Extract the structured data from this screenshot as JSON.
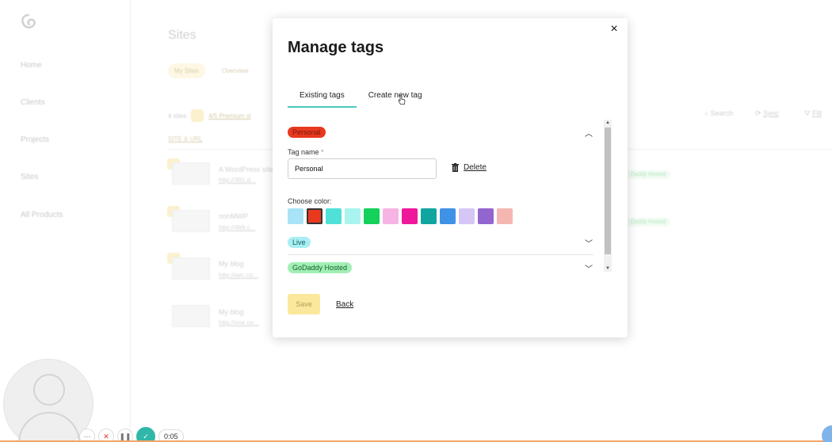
{
  "background": {
    "sidebar": {
      "items": [
        "Home",
        "Clients",
        "Projects",
        "Sites",
        "All Products"
      ]
    },
    "page_title": "Sites",
    "filter_pills": [
      "My Sites",
      "Overview"
    ],
    "summary": {
      "count": "4 sites",
      "premium": "4/5 Premium sl"
    },
    "toolbar": {
      "search": "Search",
      "sync": "Sync",
      "filter": "Filt"
    },
    "column_header": "SITE & URL",
    "rows": [
      {
        "name": "A WordPress site",
        "url": "http://391.d...",
        "badge": "Daddy Hosted"
      },
      {
        "name": "nonMWP",
        "url": "http://4b9.c...",
        "badge": "Daddy Hosted"
      },
      {
        "name": "My blog",
        "url": "http://sec.co...",
        "badge": ""
      },
      {
        "name": "My blog",
        "url": "http://one.co...",
        "badge": ""
      }
    ],
    "recorder": {
      "time": "0:05"
    }
  },
  "modal": {
    "title": "Manage tags",
    "close_symbol": "×",
    "tabs": [
      {
        "label": "Existing tags",
        "active": true
      },
      {
        "label": "Create new tag",
        "active": false
      }
    ],
    "tags": [
      {
        "label": "Personal",
        "color": "#e8391f",
        "expanded": true,
        "tag_name_label": "Tag name",
        "required_mark": "*",
        "tag_name_value": "Personal",
        "delete_label": "Delete",
        "choose_color_label": "Choose color:",
        "swatches": [
          "#a8e4f6",
          "#e8391f",
          "#4fe0d8",
          "#a9f4ee",
          "#13d15a",
          "#f6b3e4",
          "#f0189a",
          "#11a5a0",
          "#3f92e6",
          "#d5c6f5",
          "#9365cf",
          "#f5b6b2"
        ],
        "selected_swatch": 1
      },
      {
        "label": "Live",
        "color": "#a8eef2",
        "expanded": false
      },
      {
        "label": "GoDaddy Hosted",
        "color": "#a2efb6",
        "expanded": false
      }
    ],
    "save_label": "Save",
    "back_label": "Back"
  }
}
